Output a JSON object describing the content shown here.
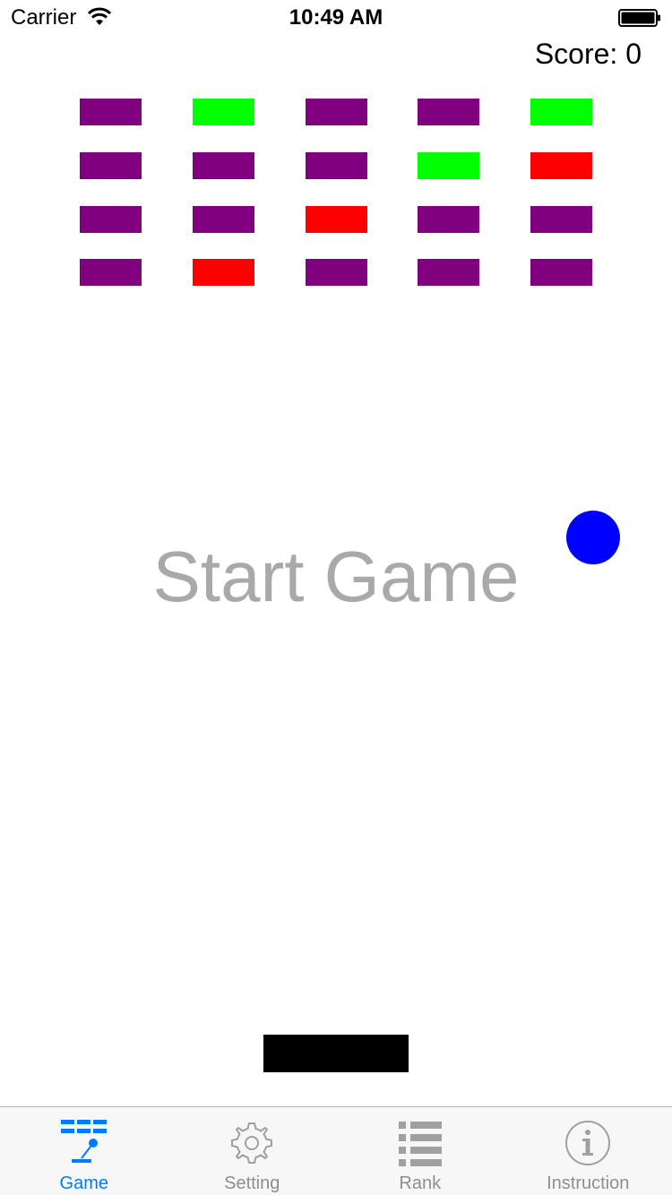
{
  "status_bar": {
    "carrier": "Carrier",
    "time": "10:49 AM",
    "wifi_icon": "wifi-icon",
    "battery_icon": "battery-icon"
  },
  "score": {
    "text": "Score: 0"
  },
  "bricks": {
    "colors": {
      "purple": "#800080",
      "green": "#00ff00",
      "red": "#ff0000"
    },
    "rows": [
      [
        "purple",
        "green",
        "purple",
        "purple",
        "green"
      ],
      [
        "purple",
        "purple",
        "purple",
        "green",
        "red"
      ],
      [
        "purple",
        "purple",
        "red",
        "purple",
        "purple"
      ],
      [
        "purple",
        "red",
        "purple",
        "purple",
        "purple"
      ]
    ]
  },
  "start_button": {
    "label": "Start Game",
    "color": "#a9a9a9"
  },
  "ball": {
    "color": "#0000ff"
  },
  "paddle": {
    "color": "#000000"
  },
  "tab_bar": {
    "active_color": "#007aff",
    "inactive_color": "#8e8e8e",
    "tabs": [
      {
        "label": "Game",
        "icon": "game-bricks-icon",
        "active": true
      },
      {
        "label": "Setting",
        "icon": "gear-icon",
        "active": false
      },
      {
        "label": "Rank",
        "icon": "list-icon",
        "active": false
      },
      {
        "label": "Instruction",
        "icon": "info-icon",
        "active": false
      }
    ]
  }
}
